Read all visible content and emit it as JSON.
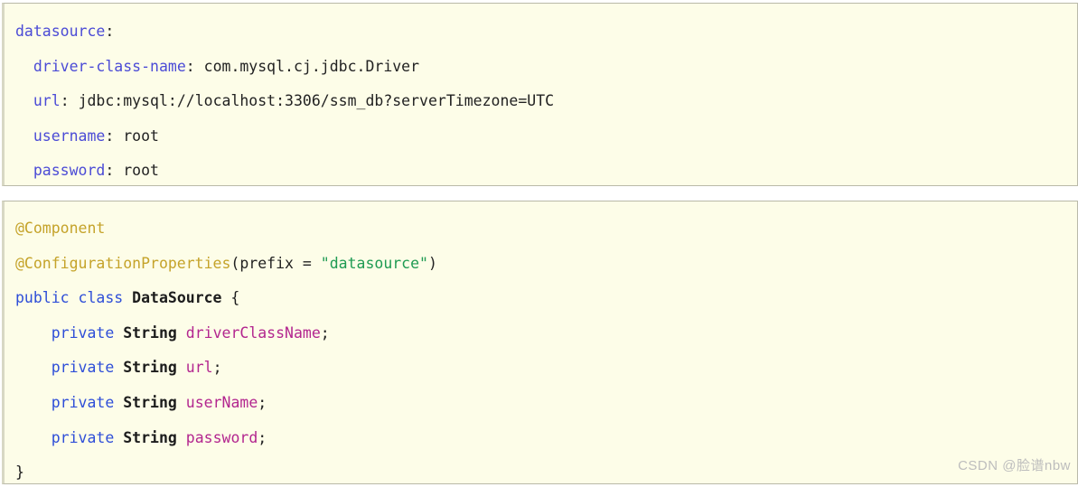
{
  "blocks": [
    {
      "id": "yaml-config",
      "language": "yaml",
      "lines": [
        {
          "indent": 0,
          "tokens": [
            {
              "text": "datasource",
              "type": "yaml-key"
            },
            {
              "text": ":",
              "type": "punct"
            }
          ]
        },
        {
          "indent": 2,
          "tokens": [
            {
              "text": "driver-class-name",
              "type": "yaml-key"
            },
            {
              "text": ": ",
              "type": "punct"
            },
            {
              "text": "com.mysql.cj.jdbc.Driver",
              "type": "plain"
            }
          ]
        },
        {
          "indent": 2,
          "tokens": [
            {
              "text": "url",
              "type": "yaml-key"
            },
            {
              "text": ": ",
              "type": "punct"
            },
            {
              "text": "jdbc:mysql://localhost:3306/ssm_db?serverTimezone=UTC",
              "type": "plain"
            }
          ]
        },
        {
          "indent": 2,
          "tokens": [
            {
              "text": "username",
              "type": "yaml-key"
            },
            {
              "text": ": ",
              "type": "punct"
            },
            {
              "text": "root",
              "type": "plain"
            }
          ]
        },
        {
          "indent": 2,
          "tokens": [
            {
              "text": "password",
              "type": "yaml-key"
            },
            {
              "text": ": ",
              "type": "punct"
            },
            {
              "text": "root",
              "type": "plain"
            }
          ]
        }
      ]
    },
    {
      "id": "java-class",
      "language": "java",
      "lines": [
        {
          "indent": 0,
          "tokens": [
            {
              "text": "@Component",
              "type": "annotation"
            }
          ]
        },
        {
          "indent": 0,
          "tokens": [
            {
              "text": "@ConfigurationProperties",
              "type": "annotation"
            },
            {
              "text": "(",
              "type": "punct"
            },
            {
              "text": "prefix",
              "type": "plain"
            },
            {
              "text": " = ",
              "type": "punct"
            },
            {
              "text": "\"datasource\"",
              "type": "string"
            },
            {
              "text": ")",
              "type": "punct"
            }
          ]
        },
        {
          "indent": 0,
          "tokens": [
            {
              "text": "public",
              "type": "keyword"
            },
            {
              "text": " ",
              "type": "plain"
            },
            {
              "text": "class",
              "type": "keyword"
            },
            {
              "text": " ",
              "type": "plain"
            },
            {
              "text": "DataSource",
              "type": "classname"
            },
            {
              "text": " {",
              "type": "brace"
            }
          ]
        },
        {
          "indent": 4,
          "tokens": [
            {
              "text": "private",
              "type": "keyword"
            },
            {
              "text": " ",
              "type": "plain"
            },
            {
              "text": "String",
              "type": "type"
            },
            {
              "text": " ",
              "type": "plain"
            },
            {
              "text": "driverClassName",
              "type": "field"
            },
            {
              "text": ";",
              "type": "punct"
            }
          ]
        },
        {
          "indent": 4,
          "tokens": [
            {
              "text": "private",
              "type": "keyword"
            },
            {
              "text": " ",
              "type": "plain"
            },
            {
              "text": "String",
              "type": "type"
            },
            {
              "text": " ",
              "type": "plain"
            },
            {
              "text": "url",
              "type": "field"
            },
            {
              "text": ";",
              "type": "punct"
            }
          ]
        },
        {
          "indent": 4,
          "tokens": [
            {
              "text": "private",
              "type": "keyword"
            },
            {
              "text": " ",
              "type": "plain"
            },
            {
              "text": "String",
              "type": "type"
            },
            {
              "text": " ",
              "type": "plain"
            },
            {
              "text": "userName",
              "type": "field"
            },
            {
              "text": ";",
              "type": "punct"
            }
          ]
        },
        {
          "indent": 4,
          "tokens": [
            {
              "text": "private",
              "type": "keyword"
            },
            {
              "text": " ",
              "type": "plain"
            },
            {
              "text": "String",
              "type": "type"
            },
            {
              "text": " ",
              "type": "plain"
            },
            {
              "text": "password",
              "type": "field"
            },
            {
              "text": ";",
              "type": "punct"
            }
          ]
        },
        {
          "indent": 0,
          "tokens": [
            {
              "text": "}",
              "type": "brace"
            }
          ]
        }
      ]
    }
  ],
  "watermark": {
    "text": "CSDN @脸谱nbw"
  },
  "colors": {
    "code_background": "#fdfde8",
    "block_border": "#b9b9a8",
    "page_background": "#ffffff",
    "yaml_key": "#4b4bd6",
    "annotation": "#c5a32a",
    "keyword": "#2e4ed8",
    "field": "#b3268f",
    "string": "#1f9b53",
    "plain_text": "#222222",
    "watermark": "#bdbdbd"
  }
}
